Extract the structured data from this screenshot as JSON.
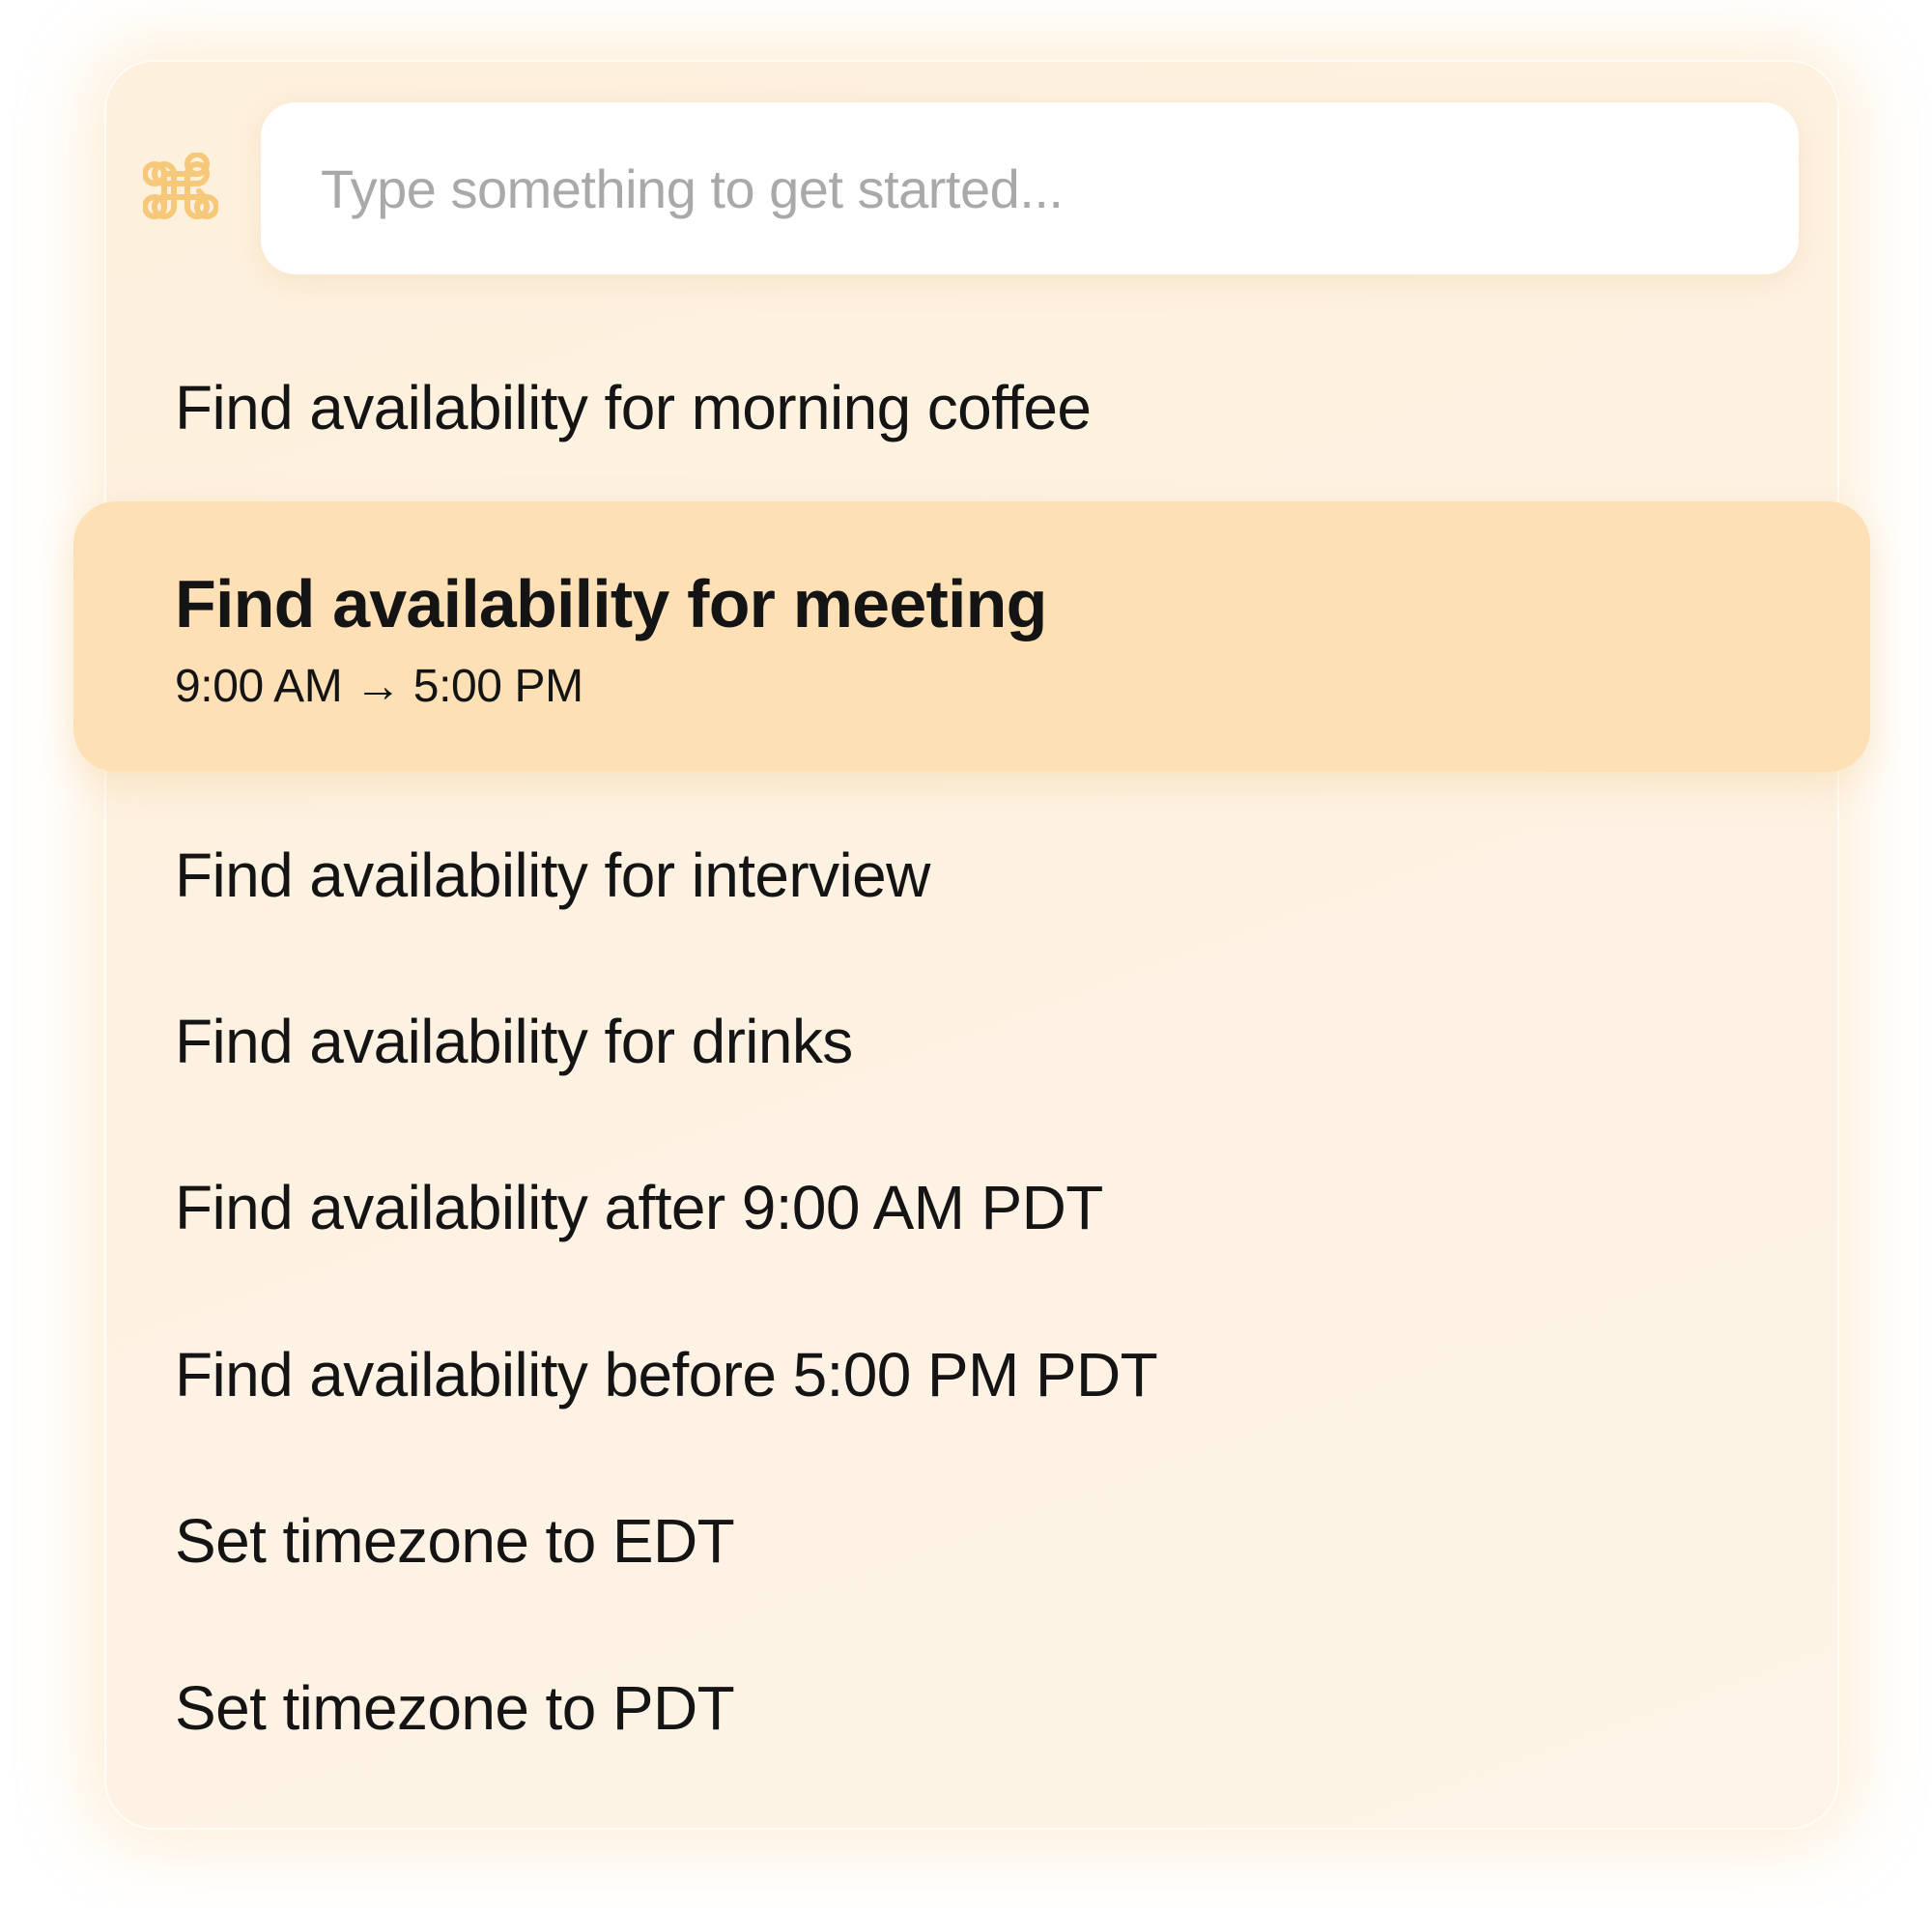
{
  "search": {
    "placeholder": "Type something to get started...",
    "value": "",
    "icon": "command-icon"
  },
  "colors": {
    "accent": "#f6c879",
    "panel": "#fdf1e0",
    "highlight": "#fde0b6",
    "text": "#141414",
    "placeholder": "#a9a9a9"
  },
  "commands": [
    {
      "label": "Find availability for morning coffee"
    },
    {
      "label": "Find availability for meeting",
      "detail": "9:00 AM → 5:00 PM",
      "selected": true
    },
    {
      "label": "Find availability for interview"
    },
    {
      "label": "Find availability for drinks"
    },
    {
      "label": "Find availability after 9:00 AM PDT"
    },
    {
      "label": "Find availability before 5:00 PM PDT"
    },
    {
      "label": "Set timezone to EDT"
    },
    {
      "label": "Set timezone to PDT"
    }
  ]
}
